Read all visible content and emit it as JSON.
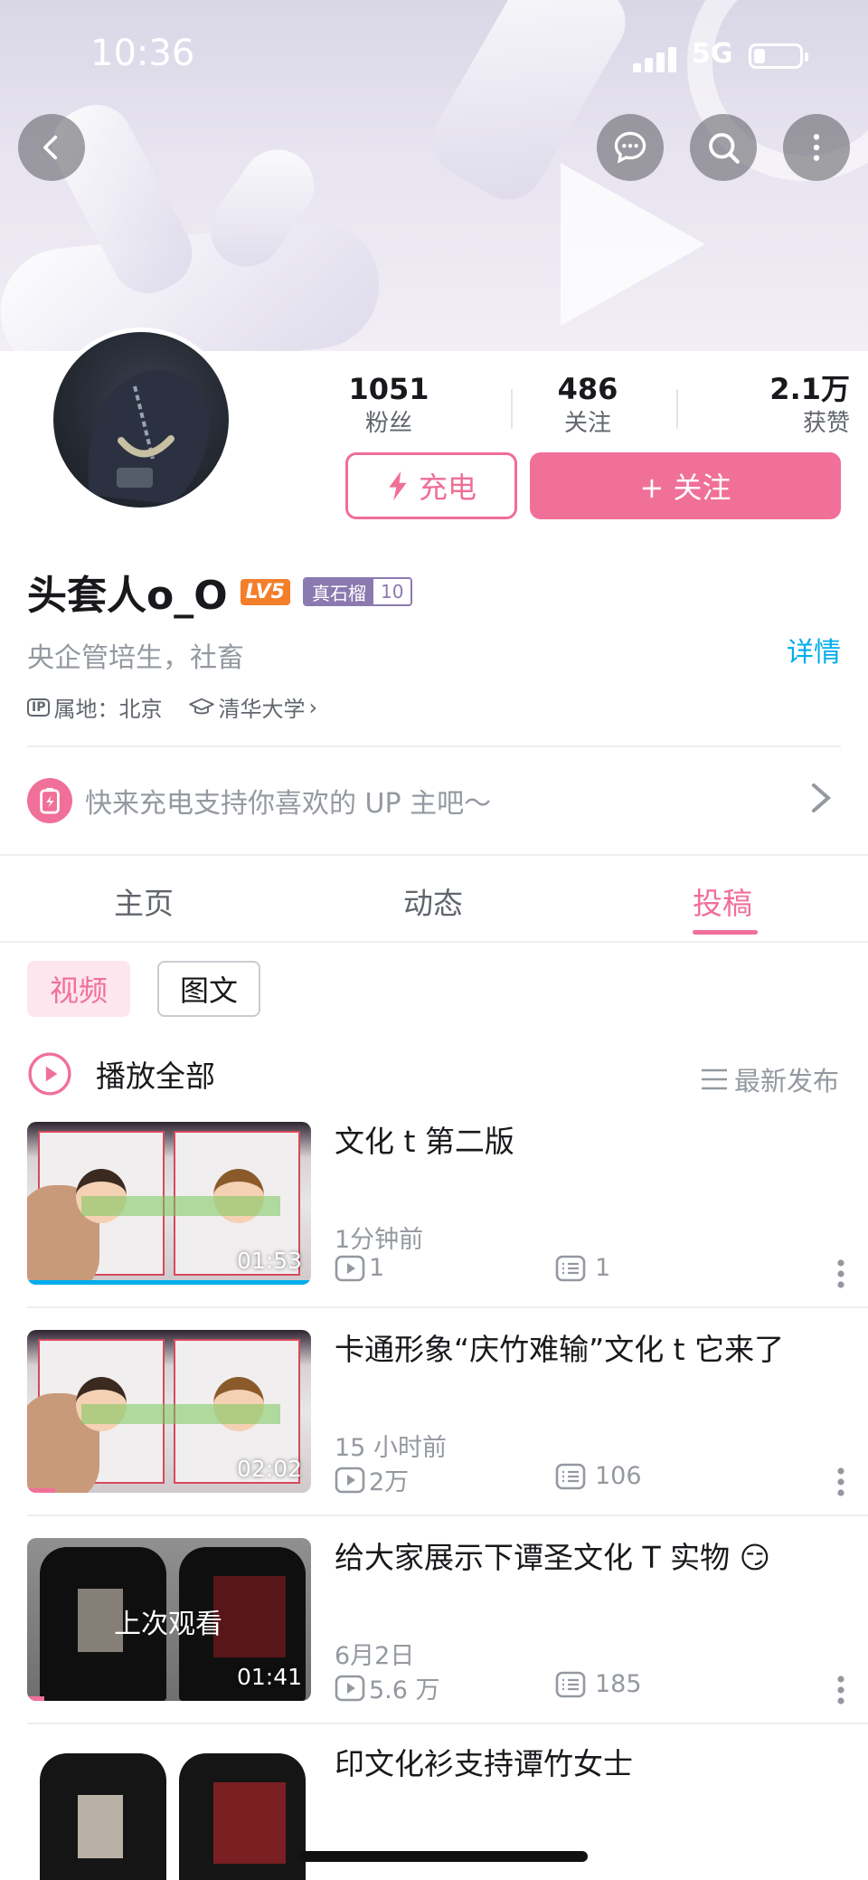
{
  "status_bar": {
    "time": "10:36",
    "network": "5G"
  },
  "header": {
    "back_icon": "chevron-left-icon",
    "message_icon": "chat-bubble-icon",
    "search_icon": "search-icon",
    "more_icon": "vertical-dots-icon"
  },
  "stats": [
    {
      "value": "1051",
      "label": "粉丝"
    },
    {
      "value": "486",
      "label": "关注"
    },
    {
      "value": "2.1万",
      "label": "获赞"
    }
  ],
  "buttons": {
    "charge": "充电",
    "follow": "+ 关注"
  },
  "profile": {
    "name": "头套人o_O",
    "level": "LV5",
    "medal_name": "真石榴",
    "medal_level": "10",
    "signature": "央企管培生，社畜",
    "detail_link": "详情",
    "ip_badge": "IP",
    "ip_location": "属地：北京",
    "school": "清华大学",
    "school_chevron": "›"
  },
  "charge_banner": {
    "text": "快来充电支持你喜欢的 UP 主吧～"
  },
  "tabs": [
    "主页",
    "动态",
    "投稿"
  ],
  "active_tab": 2,
  "filters": {
    "video": "视频",
    "image_text": "图文"
  },
  "list_header": {
    "play_all": "播放全部",
    "sort": "最新发布"
  },
  "videos": [
    {
      "title": "文化 t 第二版",
      "time": "1分钟前",
      "plays": "1",
      "comments": "1",
      "duration": "01:53",
      "watched_label": "",
      "progress": 1.0
    },
    {
      "title": "卡通形象“庆竹难输”文化 t 它来了",
      "time": "15 小时前",
      "plays": "2万",
      "comments": "106",
      "duration": "02:02",
      "watched_label": "",
      "progress": 0.1
    },
    {
      "title": "给大家展示下谭圣文化 T 实物 😏",
      "time": "6月2日",
      "plays": "5.6 万",
      "comments": "185",
      "duration": "01:41",
      "watched_label": "上次观看",
      "progress": 0.06
    },
    {
      "title": "印文化衫支持谭竹女士",
      "time": "",
      "plays": "",
      "comments": "",
      "duration": "",
      "watched_label": "",
      "progress": 0
    }
  ],
  "colors": {
    "accent": "#f07099",
    "link": "#00aeec",
    "level": "#f47f2b",
    "medal": "#8b7ab0"
  }
}
